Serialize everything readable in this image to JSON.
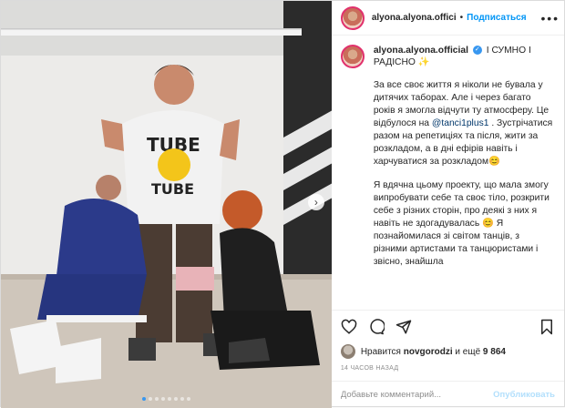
{
  "header": {
    "username": "alyona.alyona.offici",
    "separator": "•",
    "follow_label": "Подписаться",
    "more_icon": "more-options-icon"
  },
  "caption": {
    "username": "alyona.alyona.official",
    "headline": "І СУМНО І РАДІСНО",
    "headline_emoji": "✨",
    "paragraph1_a": "За все своє життя я ніколи не бувала у дитячих таборах. Але і через багато років я змогла відчути ту атмосферу. Це відбулося на ",
    "mention": "@tanci1plus1",
    "paragraph1_b": " . Зустрічатися разом на репетиціях та після, жити за розкладом, а в дні ефірів навіть і харчуватися за розкладом",
    "paragraph1_emoji": "😊",
    "paragraph2": "Я вдячна цьому проекту, що мала змогу випробувати себе та своє тіло, розкрити себе з різних сторін, про деякі з них я навіть не здогадувалась",
    "paragraph2_emoji": "😊",
    "paragraph2_b": " Я познайомилася зі світом танців, з різними артистами та танцюристами і звісно, знайшла"
  },
  "likes": {
    "prefix": "Нравится",
    "liker": "novgorodzi",
    "suffix": "и ещё",
    "count": "9 864"
  },
  "timestamp": "14 ЧАСОВ НАЗАД",
  "comment": {
    "placeholder": "Добавьте комментарий...",
    "post_label": "Опубликовать"
  },
  "carousel": {
    "total_dots": 8,
    "active_index": 0
  },
  "colors": {
    "accent": "#0095f6",
    "verified": "#3897f0",
    "post_disabled": "#b2dffc"
  }
}
